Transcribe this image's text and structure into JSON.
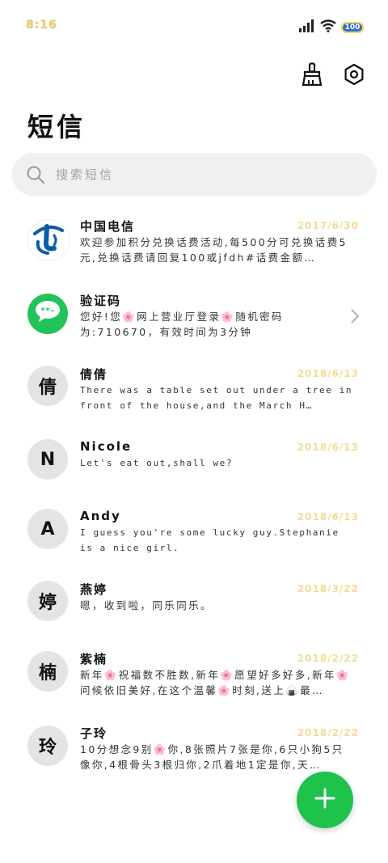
{
  "status_bar": {
    "time": "8:16",
    "battery": "100"
  },
  "header": {
    "title": "短信",
    "clean_icon": "broom-icon",
    "settings_icon": "gear-icon"
  },
  "search": {
    "placeholder": "搜索短信"
  },
  "messages": [
    {
      "avatar_text": "",
      "avatar_icon": "china-telecom-logo",
      "sender": "中国电信",
      "date": "2017/6/30",
      "preview": "欢迎参加积分兑换话费活动,每500分可兑换话费5元,兑换话费请回复100或jfdh#话费金额…"
    },
    {
      "avatar_text": "",
      "avatar_icon": "chat-bubble-icon",
      "sender": "验证码",
      "date": "",
      "preview": "您好!您🌸网上营业厅登录🌸随机密码为:710670，有效时间为3分钟"
    },
    {
      "avatar_text": "倩",
      "sender": "倩倩",
      "date": "2018/6/13",
      "preview": "There was a table set out under a tree in front of the house,and the March H…"
    },
    {
      "avatar_text": "N",
      "sender": "Nicole",
      "date": "2018/6/13",
      "preview": "Let's eat out,shall we?"
    },
    {
      "avatar_text": "A",
      "sender": "Andy",
      "date": "2018/6/13",
      "preview": "I guess you're some lucky guy.Stephanie is a nice girl."
    },
    {
      "avatar_text": "婷",
      "sender": "燕婷",
      "date": "2018/3/22",
      "preview": "嗯，收到啦，同乐同乐。"
    },
    {
      "avatar_text": "楠",
      "sender": "紫楠",
      "date": "2018/2/22",
      "preview": "新年🌸祝福数不胜数,新年🌸愿望好多好多,新年🌸问候依旧美好,在这个温馨🌸时刻,送上🍙最…"
    },
    {
      "avatar_text": "玲",
      "sender": "子玲",
      "date": "2018/2/22",
      "preview": "10分想念9别🌸你,8张照片7张是你,6只小狗5只像你,4根骨头3根归你,2爪着地1定是你,天…"
    }
  ],
  "fab": {
    "icon": "plus-icon"
  },
  "colors": {
    "fab": "#1dc34b",
    "search_bg": "#f0f0f0",
    "avatar_bg": "#e4e4e4",
    "date": "#f2dc95"
  }
}
